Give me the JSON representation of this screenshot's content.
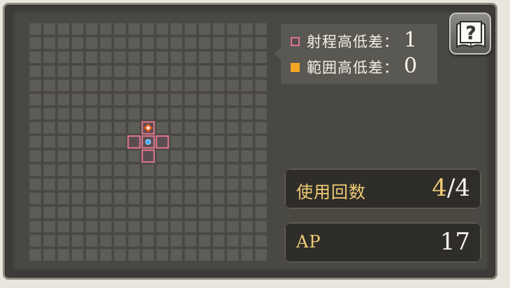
{
  "legend": {
    "range_height_label": "射程高低差：",
    "range_height_value": "1",
    "area_height_label": "範囲高低差：",
    "area_height_value": "0",
    "range_color": "#e3768f",
    "area_color": "#f5a623"
  },
  "help_button": {
    "icon": "question-book-icon",
    "symbol": "?"
  },
  "stats": {
    "uses_label": "使用回数",
    "uses_current": "4",
    "uses_separator": "/",
    "uses_max": "4",
    "ap_label": "AP",
    "ap_value": "17"
  },
  "grid": {
    "cols": 17,
    "rows": 17,
    "caster": {
      "col": 8,
      "row": 8
    },
    "target_marker": {
      "col": 8,
      "row": 7
    },
    "range_cells": [
      {
        "col": 7,
        "row": 8
      },
      {
        "col": 9,
        "row": 8
      },
      {
        "col": 8,
        "row": 9
      }
    ],
    "cell_color": "#5e5c57",
    "cell_border_color": "#4a4944",
    "range_fill": "#5a4d51",
    "caster_color": "#3aa7ff",
    "target_color": "#e2511c"
  }
}
